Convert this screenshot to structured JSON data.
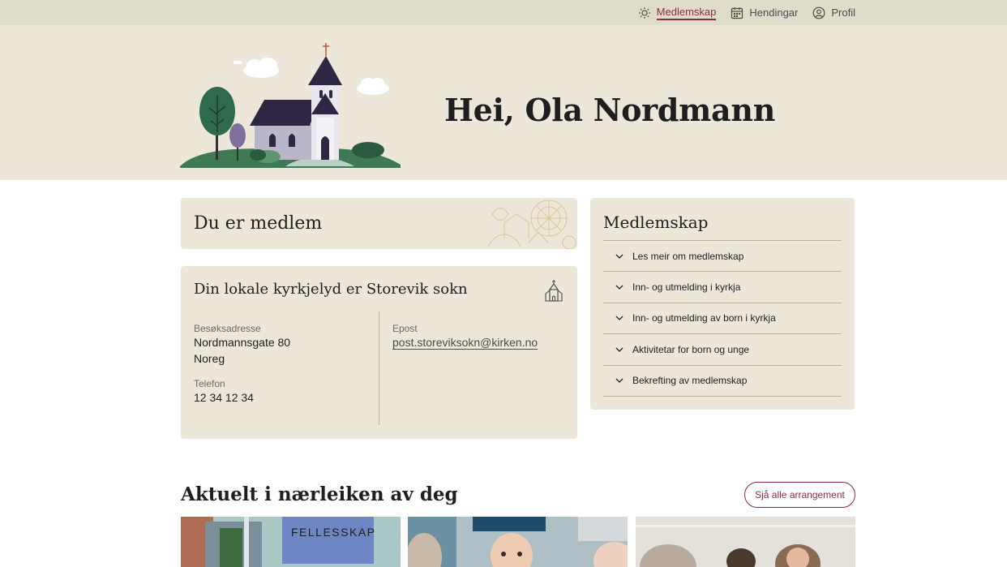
{
  "topnav": {
    "items": [
      {
        "label": "Medlemskap",
        "icon": "sun-icon",
        "active": true
      },
      {
        "label": "Hendingar",
        "icon": "calendar-icon",
        "active": false
      },
      {
        "label": "Profil",
        "icon": "user-circle-icon",
        "active": false
      }
    ]
  },
  "hero": {
    "title": "Hei, Ola Nordmann"
  },
  "member_card": {
    "title": "Du er medlem"
  },
  "local_card": {
    "title": "Din lokale kyrkjelyd er Storevik sokn",
    "address_label": "Besøksadresse",
    "address_line1": "Nordmannsgate 80",
    "address_line2": "Noreg",
    "phone_label": "Telefon",
    "phone": "12 34 12 34",
    "email_label": "Epost",
    "email": "post.storeviksokn@kirken.no"
  },
  "membership_panel": {
    "title": "Medlemskap",
    "items": [
      "Les meir om medlemskap",
      "Inn- og utmelding i kyrkja",
      "Inn- og utmelding av born i kyrkja",
      "Aktivitetar for born og unge",
      "Bekrefting av medlemskap"
    ]
  },
  "news": {
    "title": "Aktuelt i nærleiken av deg",
    "see_all_label": "Sjå alle arrangement",
    "card1_caption": "FELLESSKAP"
  },
  "colors": {
    "accent": "#8b2a46",
    "topbar": "#e0dccb",
    "hero_bg": "#ece7d8",
    "card_bg": "#ece7d8"
  }
}
